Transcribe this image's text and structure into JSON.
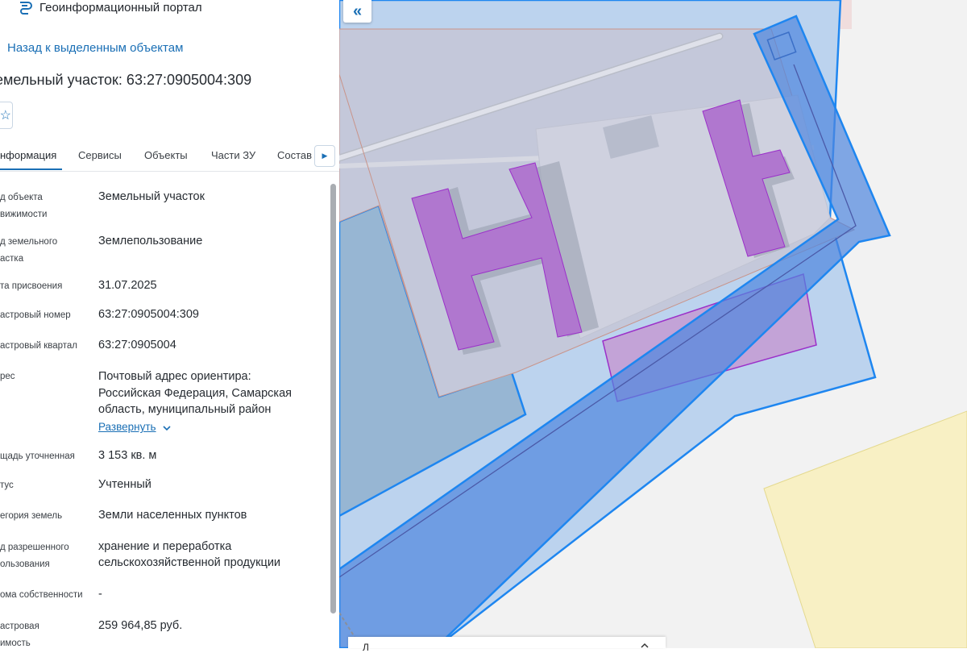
{
  "app": {
    "title": "Геоинформационный портал"
  },
  "nav": {
    "back_label": "Назад к выделенным объектам"
  },
  "object": {
    "title": "емельный участок: 63:27:0905004:309"
  },
  "tabs": [
    {
      "label": "нформация"
    },
    {
      "label": "Сервисы"
    },
    {
      "label": "Объекты"
    },
    {
      "label": "Части ЗУ"
    },
    {
      "label": "Состав"
    }
  ],
  "properties": [
    {
      "label_lines": [
        "д объекта",
        "вижимости"
      ],
      "value": "Земельный участок"
    },
    {
      "label_lines": [
        "д земельного",
        "астка"
      ],
      "value": "Землепользование"
    },
    {
      "label_lines": [
        "та присвоения"
      ],
      "value": "31.07.2025"
    },
    {
      "label_lines": [
        "астровый номер"
      ],
      "value": "63:27:0905004:309"
    },
    {
      "label_lines": [
        "астровый квартал"
      ],
      "value": "63:27:0905004"
    },
    {
      "label_lines": [
        "рес"
      ],
      "value_lines": [
        "Почтовый адрес ориентира:",
        "Российская Федерация, Самарская",
        "область, муниципальный район"
      ],
      "expand_label": "Развернуть"
    },
    {
      "label_lines": [
        "щадь уточненная"
      ],
      "value": "3 153 кв. м"
    },
    {
      "label_lines": [
        "тус"
      ],
      "value": "Учтенный"
    },
    {
      "label_lines": [
        "егория земель"
      ],
      "value": "Земли населенных пунктов"
    },
    {
      "label_lines": [
        "д разрешенного",
        "ользования"
      ],
      "value_lines": [
        "хранение и переработка",
        "сельскохозяйственной продукции"
      ]
    },
    {
      "label_lines": [
        "ома собственности"
      ],
      "value": "-"
    },
    {
      "label_lines": [
        "астровая",
        "имость"
      ],
      "value": "259 964,85 руб."
    }
  ],
  "bottom_card": {
    "label": "Л"
  },
  "colors": {
    "accent": "#1a6fb5",
    "parcel_fill": "#bcd3ee",
    "parcel_stroke": "#1e86f0",
    "highlight_fill": "#b88fd6",
    "highlight_stroke": "#9b30c9",
    "yellow_zone": "#f8f0c4"
  },
  "icons": {
    "logo": "portal-logo-icon",
    "favorite": "star-icon",
    "collapse": "double-chevron-left-icon",
    "tabs_next": "caret-right-icon",
    "expand": "chevron-down-icon"
  }
}
